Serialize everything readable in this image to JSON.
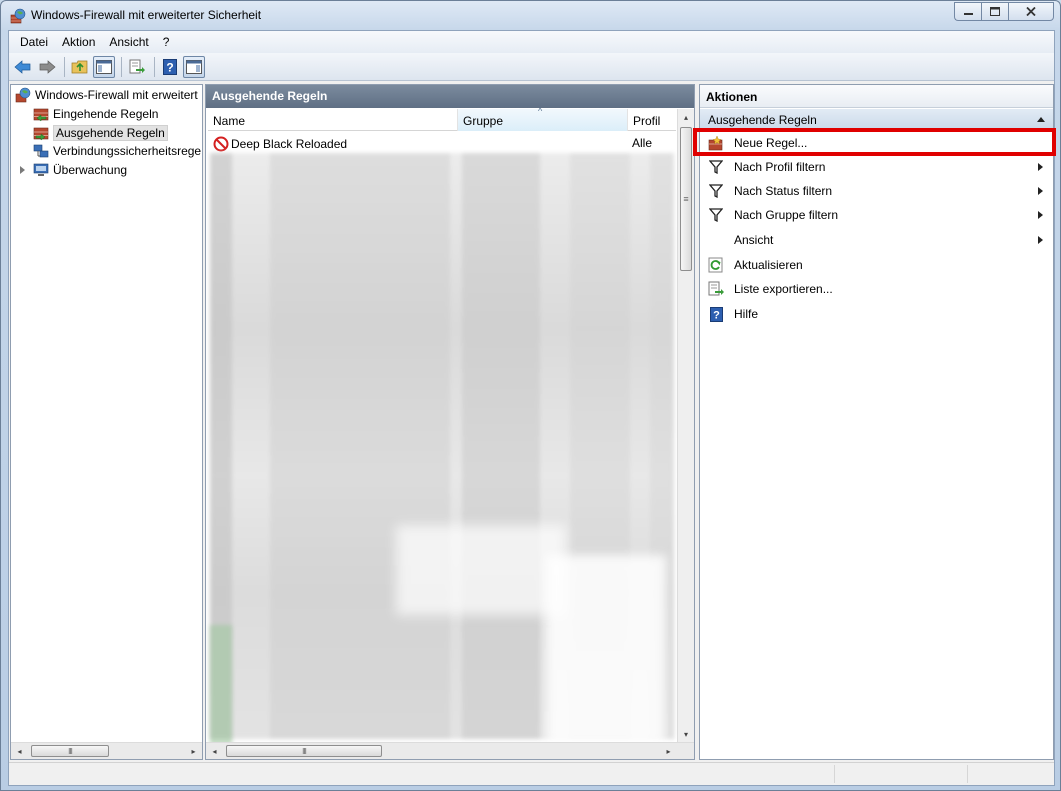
{
  "window": {
    "title": "Windows-Firewall mit erweiterter Sicherheit"
  },
  "menu": [
    "Datei",
    "Aktion",
    "Ansicht",
    "?"
  ],
  "tree": {
    "items": [
      {
        "label": "Windows-Firewall mit erweitert",
        "icon": "firewall-icon"
      },
      {
        "label": "Eingehende Regeln",
        "icon": "inbound-rules-icon"
      },
      {
        "label": "Ausgehende Regeln",
        "icon": "outbound-rules-icon"
      },
      {
        "label": "Verbindungssicherheitsrege",
        "icon": "connection-security-icon"
      },
      {
        "label": "Überwachung",
        "icon": "monitor-icon"
      }
    ],
    "selected": "Ausgehende Regeln"
  },
  "middle": {
    "header": "Ausgehende Regeln",
    "columns": [
      "Name",
      "Gruppe",
      "Profil"
    ],
    "rows": [
      {
        "name": "Deep Black Reloaded",
        "group": "",
        "profile": "Alle",
        "icon": "blocked-icon"
      }
    ]
  },
  "actions": {
    "header": "Aktionen",
    "section": "Ausgehende Regeln",
    "items": [
      {
        "label": "Neue Regel...",
        "icon": "new-rule-icon",
        "submenu": false
      },
      {
        "label": "Nach Profil filtern",
        "icon": "filter-icon",
        "submenu": true
      },
      {
        "label": "Nach Status filtern",
        "icon": "filter-icon",
        "submenu": true
      },
      {
        "label": "Nach Gruppe filtern",
        "icon": "filter-icon",
        "submenu": true
      },
      {
        "label": "Ansicht",
        "icon": "",
        "submenu": true
      },
      {
        "label": "Aktualisieren",
        "icon": "refresh-icon",
        "submenu": false
      },
      {
        "label": "Liste exportieren...",
        "icon": "export-icon",
        "submenu": false
      },
      {
        "label": "Hilfe",
        "icon": "help-icon",
        "submenu": false
      }
    ]
  },
  "scroll_glyphs": {
    "left": "◂",
    "right": "▸",
    "up": "▴",
    "down": "▾",
    "grip": "III",
    "vgrip": "≡",
    "sort": "^"
  },
  "colors": {
    "highlight": "#e00000",
    "header_dark": "#6a7a8f"
  }
}
